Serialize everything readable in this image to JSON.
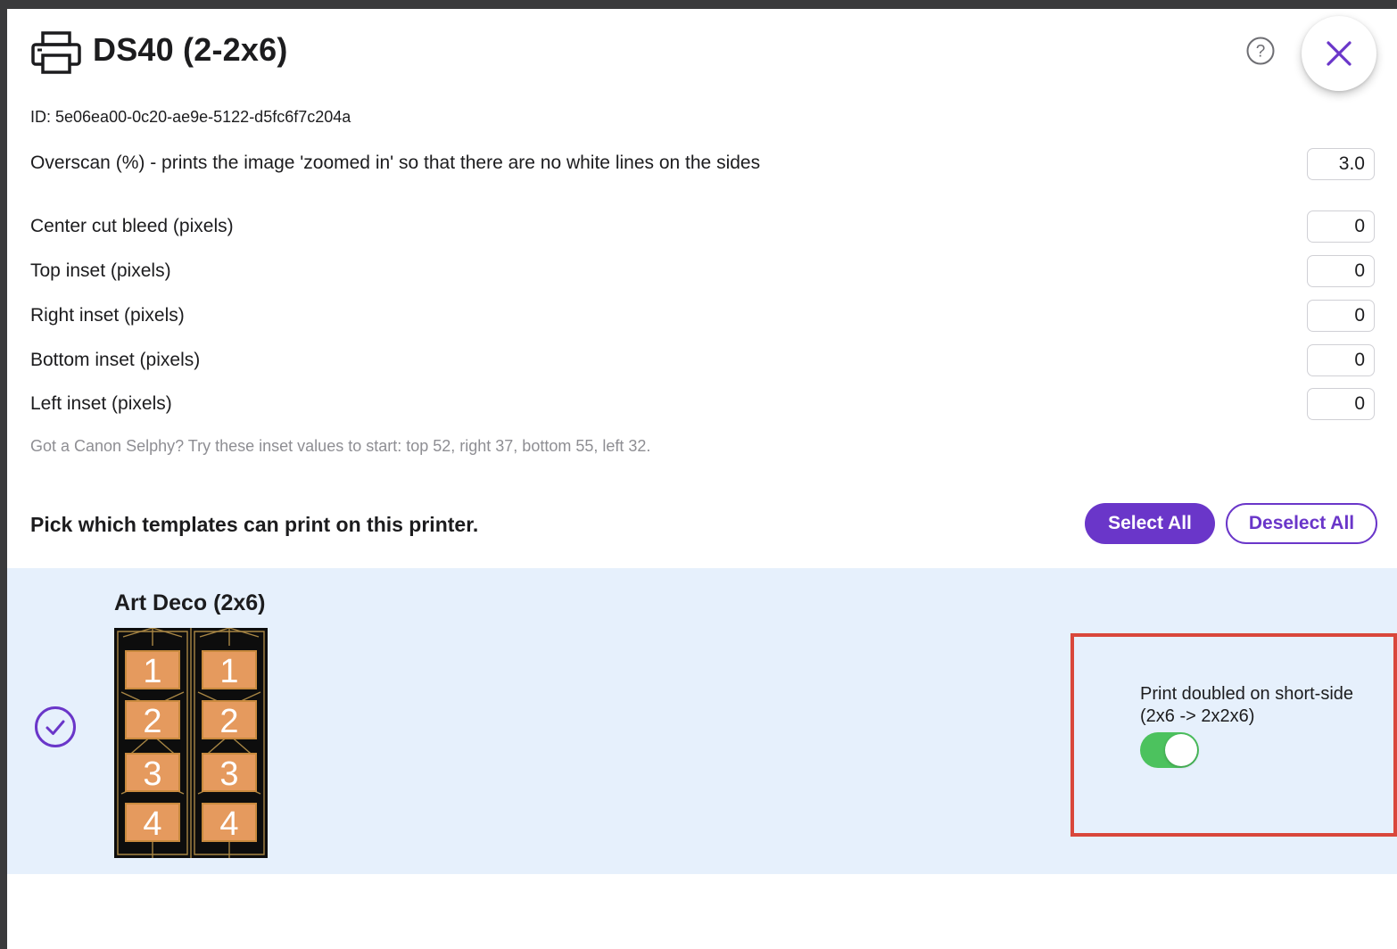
{
  "header": {
    "title": "DS40 (2-2x6)",
    "printer_icon": "printer-icon",
    "help_icon": "help-circle-icon",
    "close_icon": "close-x-icon"
  },
  "printer_id_text": "ID: 5e06ea00-0c20-ae9e-5122-d5fc6f7c204a",
  "settings": {
    "overscan": {
      "label": "Overscan (%) - prints the image 'zoomed in' so that there are no white lines on the sides",
      "value": "3.0"
    },
    "center_cut_bleed": {
      "label": "Center cut bleed (pixels)",
      "value": "0"
    },
    "top_inset": {
      "label": "Top inset (pixels)",
      "value": "0"
    },
    "right_inset": {
      "label": "Right inset (pixels)",
      "value": "0"
    },
    "bottom_inset": {
      "label": "Bottom inset (pixels)",
      "value": "0"
    },
    "left_inset": {
      "label": "Left inset (pixels)",
      "value": "0"
    }
  },
  "hint": "Got a Canon Selphy? Try these inset values to start: top 52, right 37, bottom 55, left 32.",
  "templates": {
    "heading": "Pick which templates can print on this printer.",
    "select_all_label": "Select All",
    "deselect_all_label": "Deselect All",
    "items": [
      {
        "name": "Art Deco (2x6)",
        "selected": true,
        "thumbnail_numbers": [
          "1",
          "2",
          "3",
          "4"
        ],
        "toggle_label": "Print doubled on short-side (2x6 -> 2x2x6)",
        "toggle_on": true
      }
    ]
  },
  "colors": {
    "accent": "#6a36c9",
    "row_background": "#e6f0fc",
    "toggle_on": "#4cc25e",
    "highlight_border": "#d9473b"
  }
}
